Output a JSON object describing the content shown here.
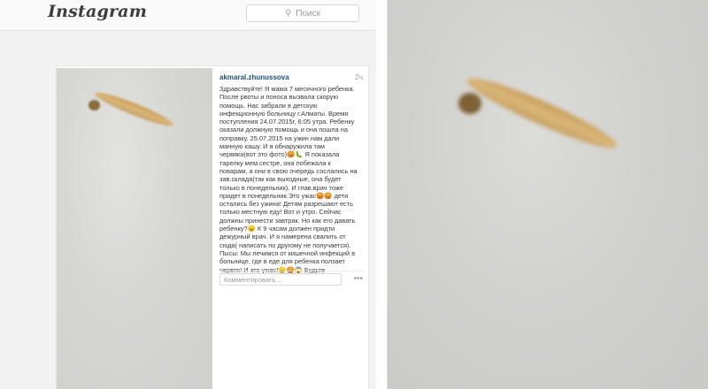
{
  "header": {
    "logo": "Instagram",
    "search_placeholder": "Поиск",
    "search_icon": "search-icon"
  },
  "post": {
    "username": "akmaral.zhunussova",
    "time": "2ч.",
    "caption": "Здравствуйте! Я мама 7 месячного ребенка.\nПосле рвоты и поноса вызвала скорую\nпомощь. Нас забрали в детскую\nинфекционную больницу г.Алматы. Время\nпоступления 24.07.2015г, 6:05 утра. Ребенку\nоказали должную помощь и она пошла на\nпоправку. 25.07.2015 на ужин нам дали\nманную кашу. И я обнаружила там\nчервяка(вот это фото)😡🐛 Я показала\nтарелку мем.сестре, она побежала к\nповарам, а они в свою очередь сослались на\nзав.склада(так как выходные, она будет\nтолько в понедельник). И глав.врач тоже\nпридет в понедельник.Это ужас😡😡 дети\nостались без ужина! Детям разрешают есть\nтолько местную еду! Вот и утро. Сейчас\nдолжны принести завтрак. Но как его давать\nребенку?😠 К 9 часам должен придти\nдежурный врач. И я намерена свалить от\nсюда( написать по другому не получается).\nПысы: Мы лечимся от кишечной инфекций в\nбольнице, где в еде для ребенка ползает\nчервяк! И это ужас!😠😡😱 Будьте\nбдительны!",
    "comment_placeholder": "Комментировать...",
    "more_label": "•••"
  }
}
